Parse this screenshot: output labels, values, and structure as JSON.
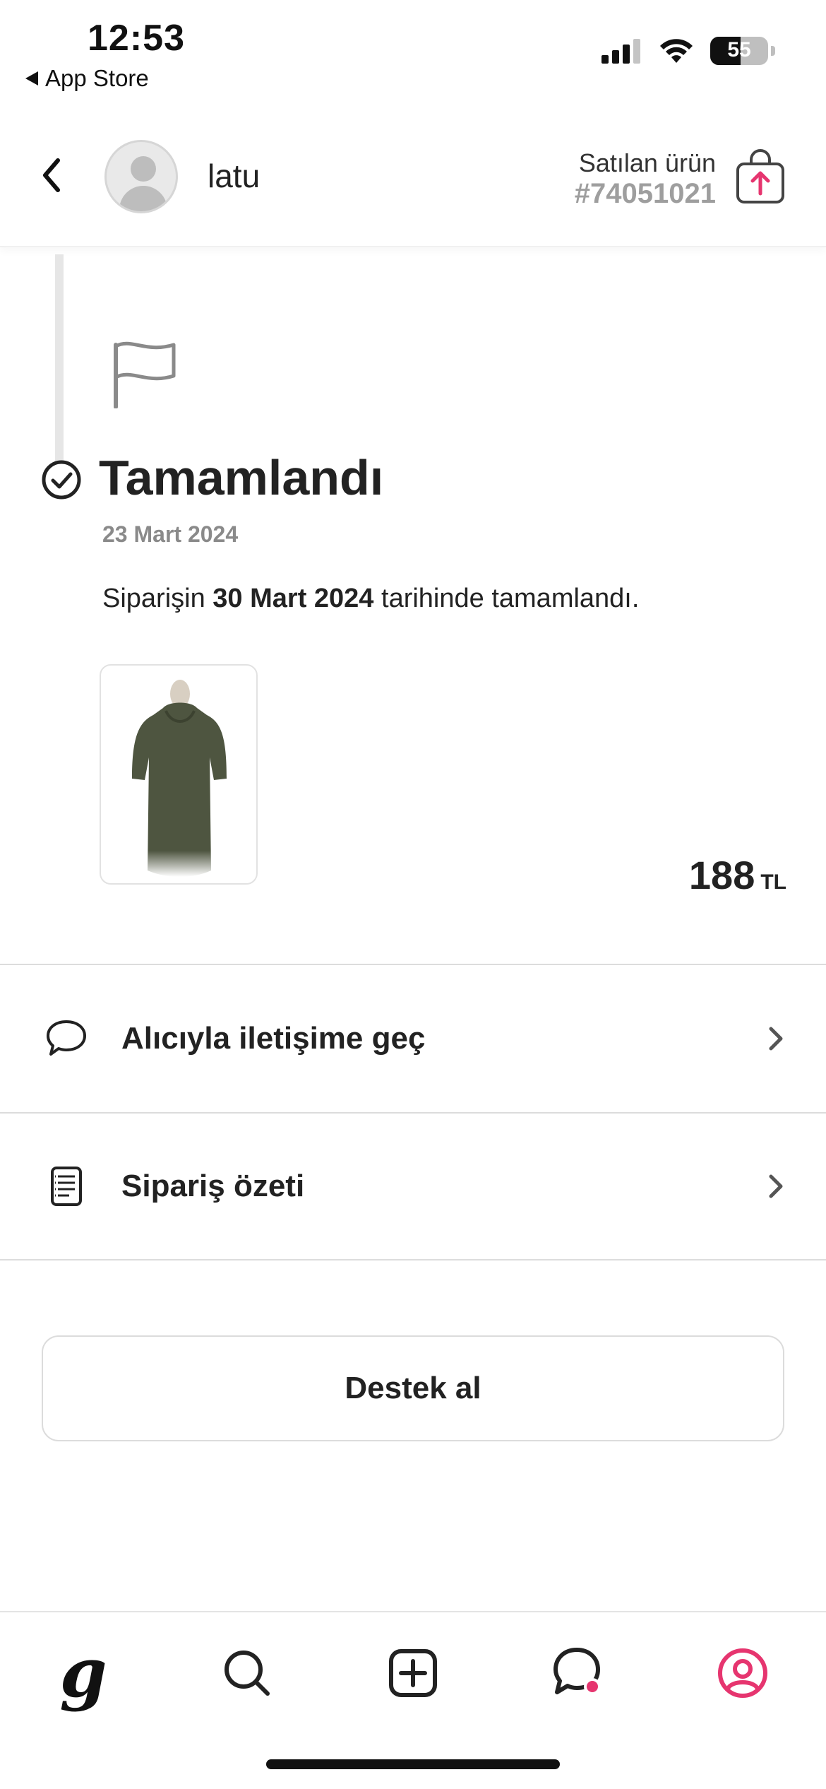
{
  "status_bar": {
    "time": "12:53",
    "back_app": "App Store",
    "battery": "55"
  },
  "header": {
    "username": "latu",
    "sold_label": "Satılan ürün",
    "sold_id": "#74051021"
  },
  "order": {
    "status_title": "Tamamlandı",
    "status_date": "23 Mart 2024",
    "desc_prefix": "Siparişin ",
    "desc_date": "30 Mart 2024",
    "desc_suffix": " tarihinde tamamlandı.",
    "price": "188",
    "currency": "TL"
  },
  "menu": {
    "contact_label": "Alıcıyla iletişime geç",
    "summary_label": "Sipariş özeti"
  },
  "support_button": "Destek al",
  "colors": {
    "accent": "#E6356F",
    "text": "#222222",
    "muted": "#9E9E9E"
  }
}
